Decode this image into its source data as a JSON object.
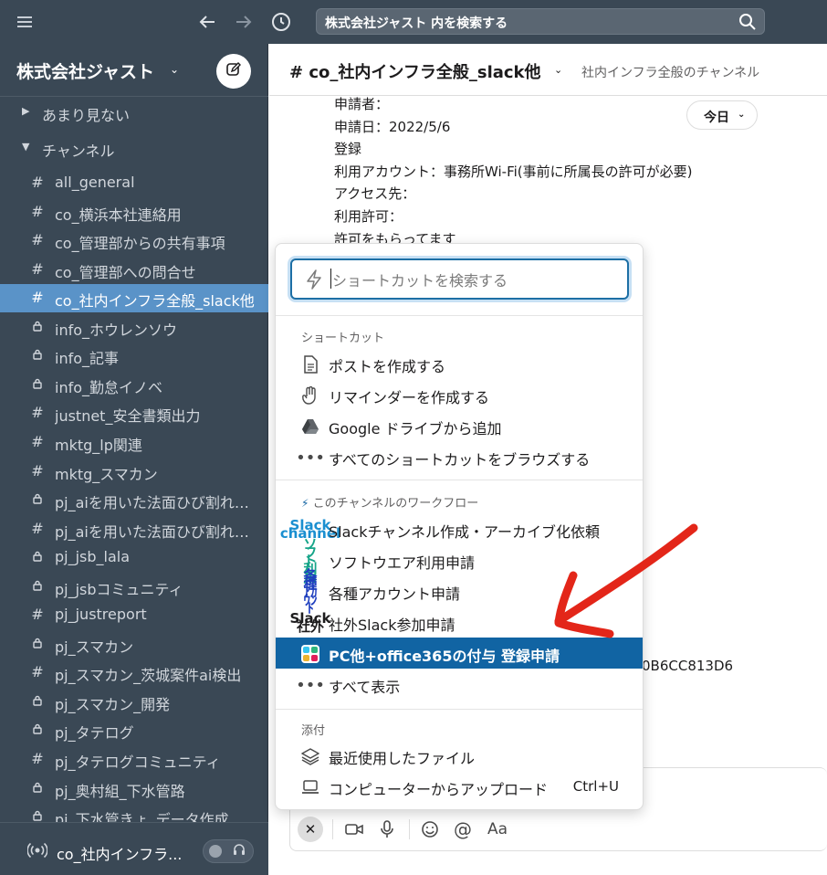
{
  "topbar": {
    "search_text": "株式会社ジャスト 内を検索する"
  },
  "sidebar": {
    "workspace_name": "株式会社ジャスト",
    "sections": [
      {
        "label": "あまり見ない"
      },
      {
        "label": "チャンネル"
      }
    ],
    "channels": [
      {
        "name": "all_general",
        "type": "hash"
      },
      {
        "name": "co_横浜本社連絡用",
        "type": "hash"
      },
      {
        "name": "co_管理部からの共有事項",
        "type": "hash"
      },
      {
        "name": "co_管理部への問合せ",
        "type": "hash"
      },
      {
        "name": "co_社内インフラ全般_slack他",
        "type": "hash",
        "active": true
      },
      {
        "name": "info_ホウレンソウ",
        "type": "lock"
      },
      {
        "name": "info_記事",
        "type": "lock"
      },
      {
        "name": "info_勤怠イノベ",
        "type": "lock"
      },
      {
        "name": "justnet_安全書類出力",
        "type": "hash"
      },
      {
        "name": "mktg_lp関連",
        "type": "hash"
      },
      {
        "name": "mktg_スマカン",
        "type": "hash"
      },
      {
        "name": "pj_aiを用いた法面ひび割れ検出",
        "type": "lock"
      },
      {
        "name": "pj_aiを用いた法面ひび割れ解析",
        "type": "hash"
      },
      {
        "name": "pj_jsb_lala",
        "type": "lock"
      },
      {
        "name": "pj_jsbコミュニティ",
        "type": "lock"
      },
      {
        "name": "pj_justreport",
        "type": "hash"
      },
      {
        "name": "pj_スマカン",
        "type": "lock"
      },
      {
        "name": "pj_スマカン_茨城案件ai検出",
        "type": "hash"
      },
      {
        "name": "pj_スマカン_開発",
        "type": "lock"
      },
      {
        "name": "pj_タテログ",
        "type": "lock"
      },
      {
        "name": "pj_タテログコミュニティ",
        "type": "hash"
      },
      {
        "name": "pj_奥村組_下水管路",
        "type": "lock"
      },
      {
        "name": "pj_下水管きょ_データ作成",
        "type": "lock"
      }
    ],
    "huddle_name": "co_社内インフラ..."
  },
  "channel": {
    "title": "co_社内インフラ全般_slack他",
    "topic": "社内インフラ全般のチャンネル",
    "date_pill": "今日",
    "message_lines": [
      "申請者：",
      "申請日：2022/5/6",
      "登録",
      "利用アカウント：事務所Wi-Fi(事前に所属長の許可が必要)",
      "アクセス先：",
      "利用許可：",
      "許可をもらってます"
    ],
    "hash_fragment": "0B6CC813D6"
  },
  "popup": {
    "search_placeholder": "ショートカットを検索する",
    "shortcuts_header": "ショートカット",
    "shortcuts": [
      {
        "label": "ポストを作成する",
        "icon": "document-icon"
      },
      {
        "label": "リマインダーを作成する",
        "icon": "hand-icon"
      },
      {
        "label": "Google ドライブから追加",
        "icon": "google-drive-icon"
      },
      {
        "label": "すべてのショートカットをブラウズする",
        "icon": "ellipsis-icon"
      }
    ],
    "workflows_header": "このチャンネルのワークフロー",
    "workflows": [
      {
        "label": "Slackチャンネル作成・アーカイブ化依頼",
        "icon_text": "Slack channel",
        "icon_color": "#1a8fd0"
      },
      {
        "label": "ソフトウエア利用申請",
        "icon_text": "ソフト 利用",
        "icon_color": "#17a589"
      },
      {
        "label": "各種アカウント申請",
        "icon_text": "各種 アカウント",
        "icon_color": "#1f3fbf"
      },
      {
        "label": "社外Slack参加申請",
        "icon_text": "Slack 社外",
        "icon_color": "#1d1c1d"
      },
      {
        "label": "PC他+office365の付与 登録申請",
        "icon_text": "",
        "icon_color": "#ffffff",
        "selected": true
      },
      {
        "label": "すべて表示",
        "icon": "ellipsis-icon"
      }
    ],
    "attach_header": "添付",
    "attach": [
      {
        "label": "最近使用したファイル",
        "icon": "layers-icon"
      },
      {
        "label": "コンピューターからアップロード",
        "icon": "laptop-icon",
        "shortcut": "Ctrl+U"
      }
    ]
  },
  "colors": {
    "sidebar_bg": "#3a4855",
    "active_channel": "#5a93c8",
    "selected_item": "#1164a3",
    "annotation_arrow": "#e32619"
  }
}
